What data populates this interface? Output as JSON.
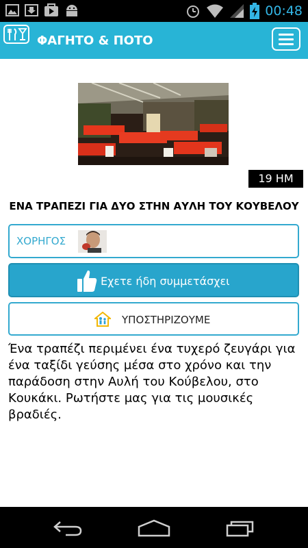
{
  "status_bar": {
    "time": "00:48",
    "left_icons": [
      "gallery-icon",
      "download-icon",
      "play-store-icon",
      "android-icon"
    ],
    "right_icons": [
      "alarm-icon",
      "wifi-icon",
      "signal-icon",
      "battery-charging-icon"
    ],
    "accent_color": "#33b5e5"
  },
  "app_bar": {
    "title": "ΦΑΓΗΤΟ & ΠΟΤΟ",
    "logo_icon": "fork-knife-glass-icon",
    "menu_icon": "hamburger-menu-icon",
    "background_color": "#28b4d6"
  },
  "event": {
    "date_badge": "19 ΗΜ",
    "title": "ΕΝΑ ΤΡΑΠΕΖΙ ΓΙΑ ΔΥΟ ΣΤΗΝ ΑΥΛΗ ΤΟΥ ΚΟΥΒΕΛΟΥ",
    "description": "Ένα τραπέζι περιμένει ένα τυχερό ζευγάρι για ένα ταξίδι γεύσης μέσα στο χρόνο και την παράδοση στην Αυλή του Κούβελου, στο Κουκάκι. Ρωτήστε μας για τις μουσικές βραδιές."
  },
  "sponsor": {
    "label": "ΧΟΡΗΓΟΣ"
  },
  "participate_button": {
    "label": "Εχετε ήδη συμμετάσχει",
    "icon": "thumbs-up-icon",
    "color": "#28a5cc"
  },
  "support_button": {
    "label": "ΥΠΟΣΤΗΡΙΖΟΥΜΕ",
    "icon": "house-people-icon"
  },
  "nav_bar": {
    "buttons": [
      "back-icon",
      "home-icon",
      "recent-apps-icon"
    ]
  }
}
